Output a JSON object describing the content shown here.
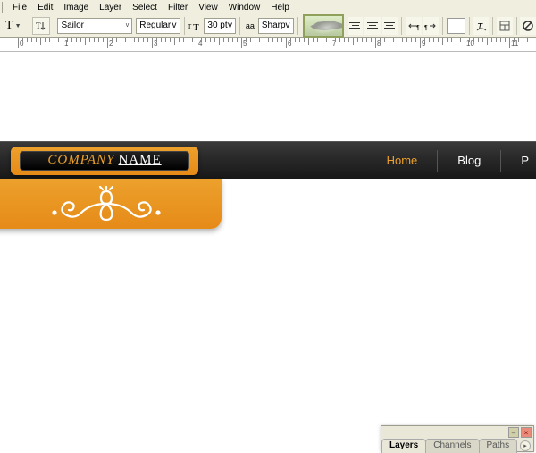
{
  "menu": [
    "File",
    "Edit",
    "Image",
    "Layer",
    "Select",
    "Filter",
    "View",
    "Window",
    "Help"
  ],
  "options": {
    "font_family": "Sailor",
    "font_style": "Regular",
    "font_size": "30 pt",
    "aa_label": "aa",
    "aa_mode": "Sharp"
  },
  "ruler": [
    "0",
    "1",
    "2",
    "3",
    "4",
    "5",
    "6",
    "7",
    "8",
    "9",
    "10",
    "11"
  ],
  "design": {
    "logo_first": "COMPANY",
    "logo_second": "NAME",
    "nav": [
      "Home",
      "Blog",
      "P"
    ],
    "nav_active_index": 0
  },
  "panel": {
    "tabs": [
      "Layers",
      "Channels",
      "Paths"
    ],
    "active_tab": 0
  }
}
